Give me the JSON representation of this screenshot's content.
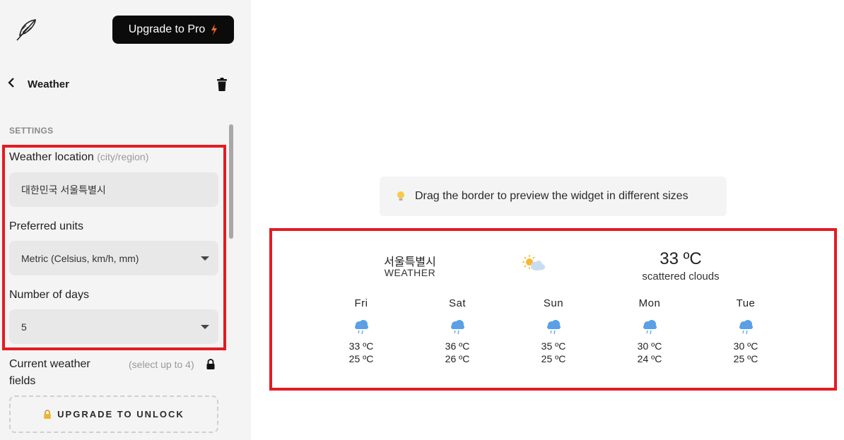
{
  "sidebar": {
    "upgrade_button": "Upgrade to Pro",
    "header_title": "Weather",
    "settings_heading": "SETTINGS",
    "location": {
      "label": "Weather location",
      "hint": "(city/region)",
      "value": "대한민국 서울특별시"
    },
    "units": {
      "label": "Preferred units",
      "value": "Metric (Celsius, km/h, mm)"
    },
    "days": {
      "label": "Number of days",
      "value": "5"
    },
    "current_fields": {
      "label": "Current weather fields",
      "hint": "(select up to 4)"
    },
    "unlock_button": "UPGRADE TO UNLOCK"
  },
  "preview": {
    "tip": "Drag the border to preview the widget in different sizes"
  },
  "widget": {
    "city": "서울특별시",
    "subtitle": "WEATHER",
    "current_temp": "33 ºC",
    "current_desc": "scattered clouds",
    "current_icon": "sun-cloud-icon",
    "forecast": [
      {
        "day": "Fri",
        "high": "33 ºC",
        "low": "25 ºC",
        "icon": "rain-cloud-icon"
      },
      {
        "day": "Sat",
        "high": "36 ºC",
        "low": "26 ºC",
        "icon": "rain-cloud-icon"
      },
      {
        "day": "Sun",
        "high": "35 ºC",
        "low": "25 ºC",
        "icon": "rain-cloud-icon"
      },
      {
        "day": "Mon",
        "high": "30 ºC",
        "low": "24 ºC",
        "icon": "rain-cloud-icon"
      },
      {
        "day": "Tue",
        "high": "30 ºC",
        "low": "25 ºC",
        "icon": "rain-cloud-icon"
      }
    ]
  },
  "colors": {
    "accent_highlight": "#e31b23",
    "pro_button_bg": "#0b0b0b",
    "bolt": "#f26522",
    "cloud_blue": "#5aa0e6"
  }
}
